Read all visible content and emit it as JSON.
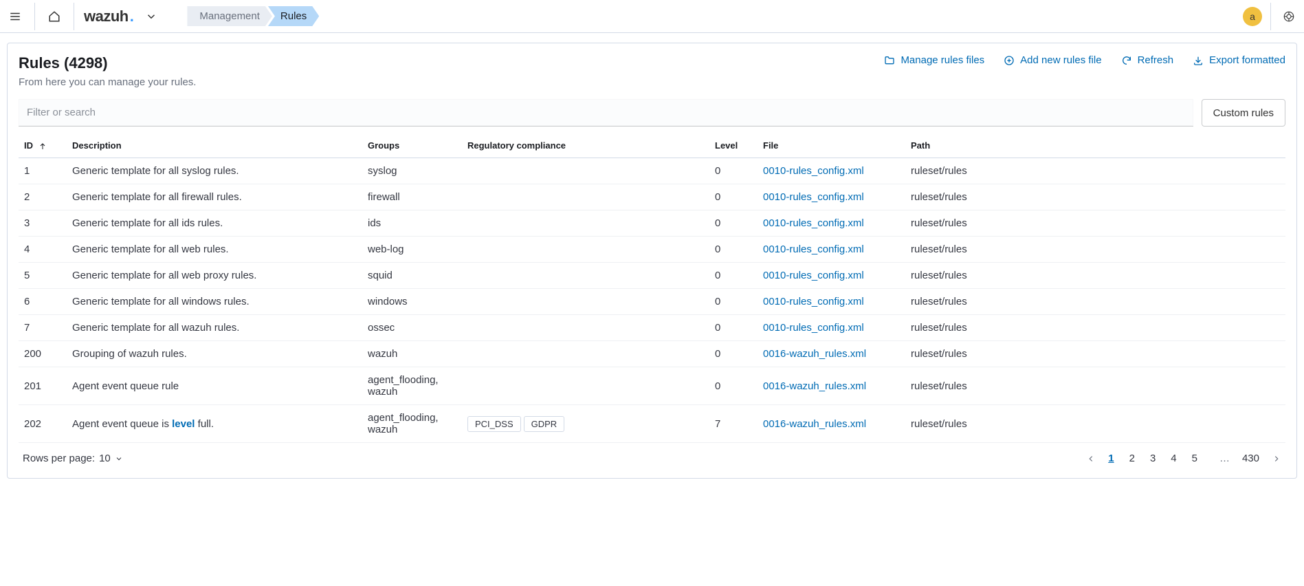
{
  "topbar": {
    "logo_text": "wazuh",
    "logo_dot": ".",
    "avatar_letter": "a"
  },
  "breadcrumb": [
    {
      "label": "Management",
      "active": false
    },
    {
      "label": "Rules",
      "active": true
    }
  ],
  "header": {
    "title": "Rules (4298)",
    "subtitle": "From here you can manage your rules."
  },
  "actions": {
    "manage_files": "Manage rules files",
    "add_new": "Add new rules file",
    "refresh": "Refresh",
    "export": "Export formatted"
  },
  "filter": {
    "placeholder": "Filter or search",
    "custom_button": "Custom rules"
  },
  "columns": {
    "id": "ID",
    "description": "Description",
    "groups": "Groups",
    "regulatory": "Regulatory compliance",
    "level": "Level",
    "file": "File",
    "path": "Path"
  },
  "rows": [
    {
      "id": "1",
      "desc": "Generic template for all syslog rules.",
      "groups": "syslog",
      "reg": [],
      "level": "0",
      "file": "0010-rules_config.xml",
      "path": "ruleset/rules"
    },
    {
      "id": "2",
      "desc": "Generic template for all firewall rules.",
      "groups": "firewall",
      "reg": [],
      "level": "0",
      "file": "0010-rules_config.xml",
      "path": "ruleset/rules"
    },
    {
      "id": "3",
      "desc": "Generic template for all ids rules.",
      "groups": "ids",
      "reg": [],
      "level": "0",
      "file": "0010-rules_config.xml",
      "path": "ruleset/rules"
    },
    {
      "id": "4",
      "desc": "Generic template for all web rules.",
      "groups": "web-log",
      "reg": [],
      "level": "0",
      "file": "0010-rules_config.xml",
      "path": "ruleset/rules"
    },
    {
      "id": "5",
      "desc": "Generic template for all web proxy rules.",
      "groups": "squid",
      "reg": [],
      "level": "0",
      "file": "0010-rules_config.xml",
      "path": "ruleset/rules"
    },
    {
      "id": "6",
      "desc": "Generic template for all windows rules.",
      "groups": "windows",
      "reg": [],
      "level": "0",
      "file": "0010-rules_config.xml",
      "path": "ruleset/rules"
    },
    {
      "id": "7",
      "desc": "Generic template for all wazuh rules.",
      "groups": "ossec",
      "reg": [],
      "level": "0",
      "file": "0010-rules_config.xml",
      "path": "ruleset/rules"
    },
    {
      "id": "200",
      "desc": "Grouping of wazuh rules.",
      "groups": "wazuh",
      "reg": [],
      "level": "0",
      "file": "0016-wazuh_rules.xml",
      "path": "ruleset/rules"
    },
    {
      "id": "201",
      "desc": "Agent event queue rule",
      "groups": "agent_flooding, wazuh",
      "reg": [],
      "level": "0",
      "file": "0016-wazuh_rules.xml",
      "path": "ruleset/rules"
    },
    {
      "id": "202",
      "desc_parts": [
        "Agent event queue is ",
        "level",
        " full."
      ],
      "groups": "agent_flooding, wazuh",
      "reg": [
        "PCI_DSS",
        "GDPR"
      ],
      "level": "7",
      "file": "0016-wazuh_rules.xml",
      "path": "ruleset/rules"
    }
  ],
  "footer": {
    "rows_per_page_label": "Rows per page: ",
    "rows_per_page_value": "10",
    "pages": [
      "1",
      "2",
      "3",
      "4",
      "5"
    ],
    "ellipsis": "…",
    "last_page": "430",
    "active_page": "1"
  }
}
